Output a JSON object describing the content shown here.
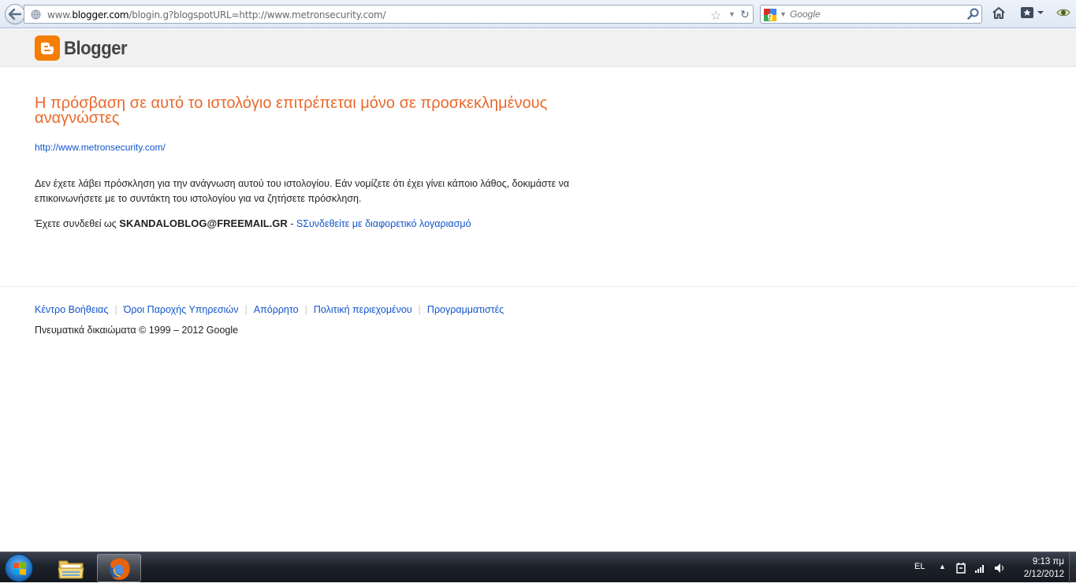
{
  "browser": {
    "url_prefix": "www.",
    "url_domain": "blogger.com",
    "url_rest": "/blogin.g?blogspotURL=http://www.metronsecurity.com/",
    "search_placeholder": "Google"
  },
  "header": {
    "logo_text": "Blogger"
  },
  "main": {
    "title": "Η πρόσβαση σε αυτό το ιστολόγιο επιτρέπεται μόνο σε προσκεκλημένους αναγνώστες",
    "blog_url": "http://www.metronsecurity.com/",
    "message": "Δεν έχετε λάβει πρόσκληση για την ανάγνωση αυτού του ιστολογίου. Εάν νομίζετε ότι έχει γίνει κάποιο λάθος, δοκιμάστε να επικοινωνήσετε με το συντάκτη του ιστολογίου για να ζητήσετε πρόσκληση.",
    "signed_in_prefix": "Έχετε συνδεθεί ως",
    "account": "SKANDALOBLOG@FREEMAIL.GR",
    "dash": "-",
    "switch_account": "SΣυνδεθείτε με διαφορετικό λογαριασμό"
  },
  "footer": {
    "links": [
      "Κέντρο Βοήθειας",
      "Όροι Παροχής Υπηρεσιών",
      "Απόρρητο",
      "Πολιτική περιεχομένου",
      "Προγραμματιστές"
    ],
    "separator": "|",
    "copyright": "Πνευματικά δικαιώματα © 1999 – 2012 Google"
  },
  "taskbar": {
    "language": "EL",
    "time": "9:13 πμ",
    "date": "2/12/2012"
  },
  "colors": {
    "title_orange": "#e9692c",
    "link_blue": "#1155cc",
    "blogger_orange": "#f57d00"
  }
}
